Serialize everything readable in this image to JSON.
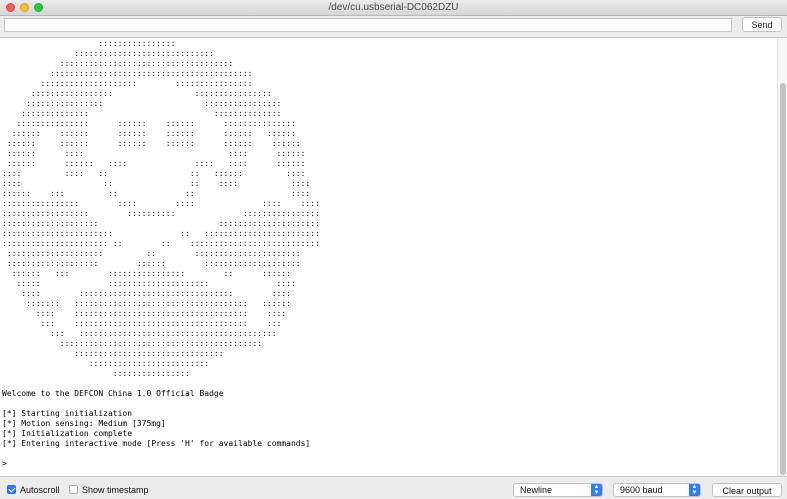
{
  "window": {
    "title": "/dev/cu.usbserial-DC062DZU"
  },
  "toolbar": {
    "input_value": "",
    "send_label": "Send"
  },
  "console": {
    "lines": [
      "                    ::::::::::::::::",
      "               :::::::::::::::::::::::::::::",
      "            ::::::::::::::::::::::::::::::::::::",
      "          ::::::::::::::::::::::::::::::::::::::::::",
      "        ::::::::::::::::::::        ::::::::::::::::",
      "      :::::::::::::::::                 ::::::::::::::::",
      "     ::::::::::::::::                     ::::::::::::::::",
      "    ::::::::::::::                          ::::::::::::::",
      "   :::::::::::::::      ::::::    ::::::      :::::::::::::::",
      "  ::::::    ::::::      ::::::    ::::::      ::::::   ::::::",
      " ::::::     ::::::      ::::::    ::::::      ::::::    ::::::",
      " ::::::      ::::                              ::::      ::::::",
      " ::::::      ::::::   ::::              ::::   ::::      ::::::",
      "::::         ::::   ::                 ::   ::::::         ::::",
      "::::                 ::                ::    ::::           ::::",
      "::::::    :::         ::              ::                    ::::",
      "::::::::::::::::        ::::        ::::              ::::    ::::",
      "::::::::::::::::::        ::::::::::              ::::::::::::::::",
      "::::::::::::::::::::                         :::::::::::::::::::::",
      ":::::::::::::::::::::::              ::   ::::::::::::::::::::::::",
      ":::::::::::::::::::::: ::        ::    :::::::::::::::::::::::::::",
      " ::::::::::::::::::::         ::        ::::::::::::::::::::::",
      " :::::::::::::::::::        ::::::        ::::::::::::::::::::",
      "  ::::::   :::        ::::::::::::::::        ::      ::::::",
      "   :::::              :::::::::::::::::::::              ::::",
      "    ::::        ::::::::::::::::::::::::::::::::        ::::",
      "     :::::::   ::::::::::::::::::::::::::::::::::::   ::::::",
      "       ::::    ::::::::::::::::::::::::::::::::::::    ::::",
      "        :::    ::::::::::::::::::::::::::::::::::::    :::",
      "          :::   :::::::::::::::::::::::::::::::::::::::::",
      "            ::::::::::::::::::::::::::::::::::::::::::",
      "               :::::::::::::::::::::::::::::::",
      "                  :::::::::::::::::::::::::",
      "                       ::::::::::::::::",
      "",
      "Welcome to the DEFCON China 1.0 Official Badge",
      "",
      "[*] Starting initialization",
      "[*] Motion sensing: Medium [375mg]",
      "[*] Initialization complete",
      "[*] Entering interactive mode [Press 'H' for available commands]",
      "",
      ">"
    ]
  },
  "scrollbar": {
    "position_fraction": 0.98,
    "visible_fraction": 0.95
  },
  "bottombar": {
    "autoscroll_label": "Autoscroll",
    "autoscroll_checked": true,
    "timestamp_label": "Show timestamp",
    "timestamp_checked": false,
    "line_ending": "Newline",
    "baud_rate": "9600 baud",
    "clear_label": "Clear output"
  },
  "colors": {
    "accent": "#2e7df6",
    "close": "#fd5f57",
    "minimize": "#febc2e",
    "maximize": "#28c840"
  }
}
